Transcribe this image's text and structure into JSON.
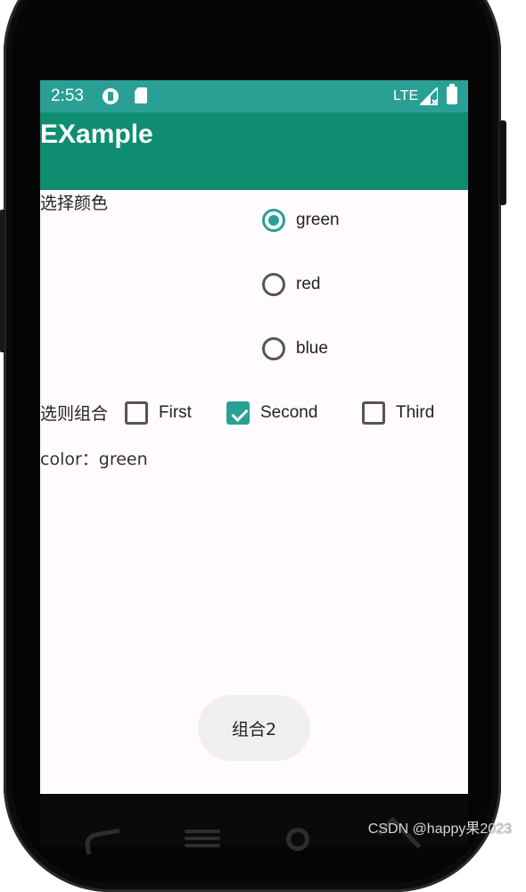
{
  "status_bar": {
    "time": "2:53",
    "network": "LTE"
  },
  "app_bar": {
    "title": "EXample"
  },
  "color_section": {
    "label": "选择颜色",
    "options": [
      {
        "label": "green",
        "checked": true
      },
      {
        "label": "red",
        "checked": false
      },
      {
        "label": "blue",
        "checked": false
      }
    ]
  },
  "checkbox_section": {
    "label": "选则组合",
    "options": [
      {
        "label": "First",
        "checked": false
      },
      {
        "label": "Second",
        "checked": true
      },
      {
        "label": "Third",
        "checked": false
      }
    ]
  },
  "status_text": "color：green",
  "bottom_button": {
    "label": "组合2"
  },
  "watermark": "CSDN @happy果2023",
  "colors": {
    "status_bar": "#2AA094",
    "app_bar": "#0E8D71",
    "accent": "#2AA094",
    "background": "#FFFBFE"
  }
}
